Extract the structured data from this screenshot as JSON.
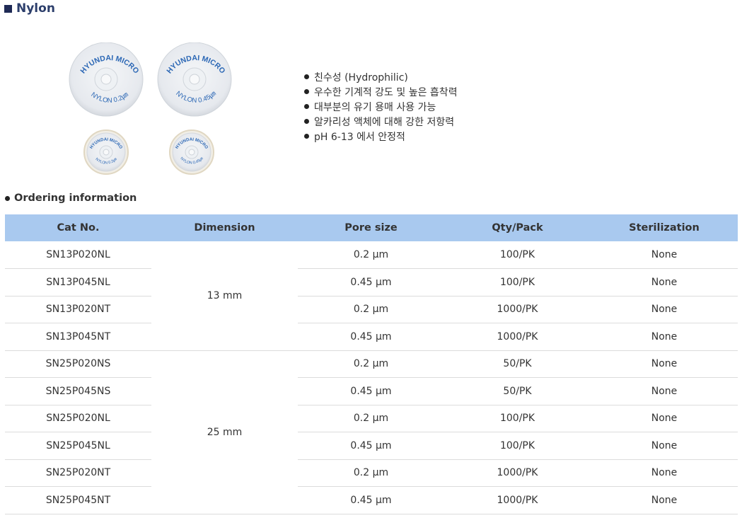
{
  "page": {
    "title": "Nylon"
  },
  "product_image": {
    "brand": "HYUNDAI MICRO",
    "labels": [
      "NYLON 0.2㎛",
      "NYLON 0.45㎛",
      "NYLON 0.2㎛",
      "NYLON 0.45㎛"
    ]
  },
  "features": [
    "친수성 (Hydrophilic)",
    "우수한 기계적 강도 및 높은 흡착력",
    "대부분의 유기 용매 사용 가능",
    "알카리성 액체에 대해 강한 저항력",
    "pH 6-13 에서 안정적"
  ],
  "ordering": {
    "title": "Ordering information",
    "headers": [
      "Cat No.",
      "Dimension",
      "Pore size",
      "Qty/Pack",
      "Sterilization"
    ],
    "dimensions": [
      "13 mm",
      "25 mm"
    ],
    "rows": [
      {
        "cat": "SN13P020NL",
        "pore": "0.2 μm",
        "qty": "100/PK",
        "ster": "None"
      },
      {
        "cat": "SN13P045NL",
        "pore": "0.45 μm",
        "qty": "100/PK",
        "ster": "None"
      },
      {
        "cat": "SN13P020NT",
        "pore": "0.2 μm",
        "qty": "1000/PK",
        "ster": "None"
      },
      {
        "cat": "SN13P045NT",
        "pore": "0.45 μm",
        "qty": "1000/PK",
        "ster": "None"
      },
      {
        "cat": "SN25P020NS",
        "pore": "0.2 μm",
        "qty": "50/PK",
        "ster": "None"
      },
      {
        "cat": "SN25P045NS",
        "pore": "0.45 μm",
        "qty": "50/PK",
        "ster": "None"
      },
      {
        "cat": "SN25P020NL",
        "pore": "0.2 μm",
        "qty": "100/PK",
        "ster": "None"
      },
      {
        "cat": "SN25P045NL",
        "pore": "0.45 μm",
        "qty": "100/PK",
        "ster": "None"
      },
      {
        "cat": "SN25P020NT",
        "pore": "0.2 μm",
        "qty": "1000/PK",
        "ster": "None"
      },
      {
        "cat": "SN25P045NT",
        "pore": "0.45 μm",
        "qty": "1000/PK",
        "ster": "None"
      }
    ]
  }
}
